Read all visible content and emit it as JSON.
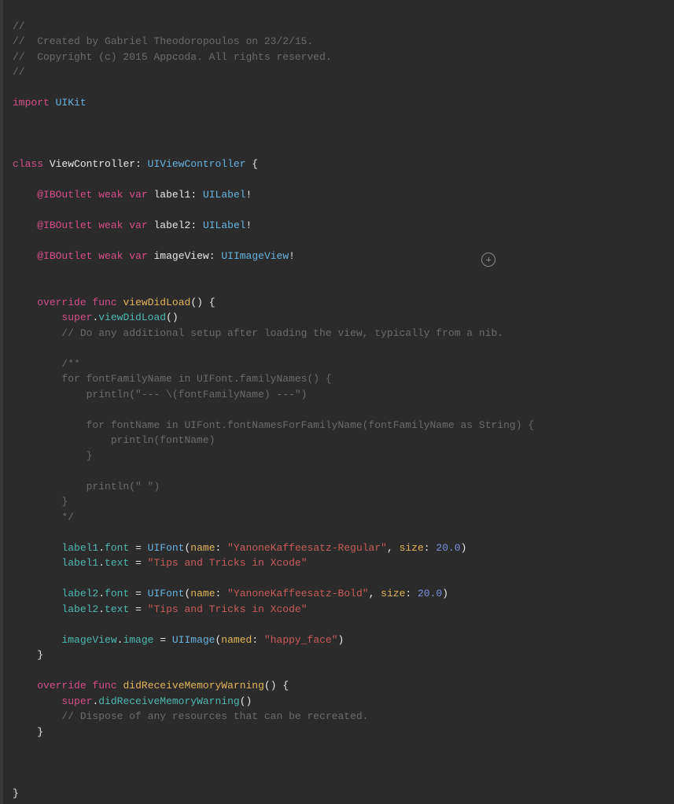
{
  "code": {
    "l1": "//",
    "l2": "//  Created by Gabriel Theodoropoulos on 23/2/15.",
    "l3": "//  Copyright (c) 2015 Appcoda. All rights reserved.",
    "l4": "//",
    "import_kw": "import",
    "import_module": "UIKit",
    "class_kw": "class",
    "class_name": "ViewController",
    "colon": ":",
    "superclass": "UIViewController",
    "brace_open": " {",
    "iboutlet": "@IBOutlet",
    "weak": "weak",
    "var_kw": "var",
    "label1": "label1",
    "label2": "label2",
    "imageView": "imageView",
    "uilabel": "UILabel",
    "uiimageview": "UIImageView",
    "bang": "!",
    "override": "override",
    "func_kw": "func",
    "viewDidLoad": "viewDidLoad",
    "empty_parens": "()",
    "super_kw": "super",
    "dot": ".",
    "viewDidLoad_call": "viewDidLoad",
    "comment_setup": "// Do any additional setup after loading the view, typically from a nib.",
    "c_block_start": "/**",
    "c_for1": "for fontFamilyName in UIFont.familyNames() {",
    "c_println1": "    println(\"--- \\(fontFamilyName) ---\")",
    "c_for2": "    for fontName in UIFont.fontNamesForFamilyName(fontFamilyName as String) {",
    "c_println2": "        println(fontName)",
    "c_brace1": "    }",
    "c_println3": "    println(\" \")",
    "c_brace2": "}",
    "c_block_end": "*/",
    "font_prop": "font",
    "equals": " = ",
    "uifont": "UIFont",
    "name_arg": "name",
    "size_arg": "size",
    "font1_name": "\"YanoneKaffeesatz-Regular\"",
    "font2_name": "\"YanoneKaffeesatz-Bold\"",
    "font_size": "20.0",
    "text_prop": "text",
    "tip_text": "\"Tips and Tricks in Xcode\"",
    "image_prop": "image",
    "uiimage": "UIImage",
    "named_arg": "named",
    "happy_face": "\"happy_face\"",
    "didReceiveMemoryWarning": "didReceiveMemoryWarning",
    "comment_dispose": "// Dispose of any resources that can be recreated.",
    "brace_close": "}",
    "comma": ", ",
    "colon_sp": ": ",
    "paren_open": "(",
    "paren_close": ")"
  }
}
